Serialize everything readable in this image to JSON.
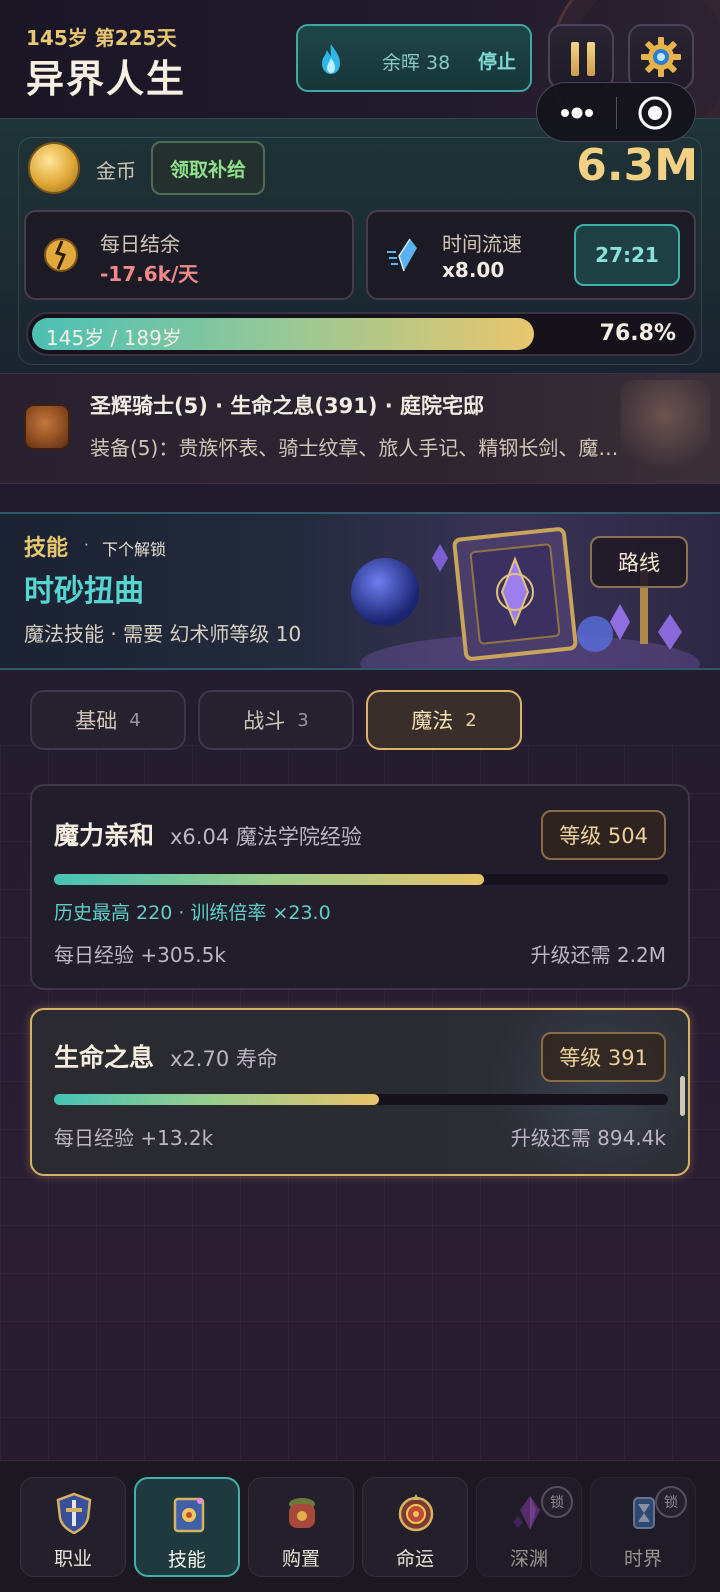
{
  "header": {
    "age_day": "145岁 第225天",
    "title": "异界人生",
    "afterglow_label": "余晖 38",
    "stop_label": "停止",
    "pause_icon": "pause-icon",
    "settings_icon": "gear-icon"
  },
  "resources": {
    "coin_label": "金币",
    "claim_button": "领取补给",
    "gold_amount": "6.3M",
    "daily_title": "每日结余",
    "daily_value": "-17.6k/天",
    "speed_title": "时间流速",
    "speed_value": "x8.00",
    "timer": "27:21",
    "life_text": "145岁 / 189岁",
    "life_percent": "76.8%",
    "life_progress": 0.768
  },
  "identity": {
    "line1": "圣辉骑士(5) · 生命之息(391) · 庭院宅邸",
    "line2": "装备(5)：贵族怀表、骑士纹章、旅人手记、精钢长剑、魔…"
  },
  "banner": {
    "section": "技能",
    "dot": "·",
    "next_unlock": "下个解锁",
    "skill_name": "时砂扭曲",
    "requirement": "魔法技能 · 需要 幻术师等级 10",
    "route_button": "路线"
  },
  "tabs": [
    {
      "label": "基础",
      "count": "4",
      "active": false
    },
    {
      "label": "战斗",
      "count": "3",
      "active": false
    },
    {
      "label": "魔法",
      "count": "2",
      "active": true
    }
  ],
  "cards": [
    {
      "name": "魔力亲和",
      "multiplier": "x6.04 魔法学院经验",
      "level": "等级 504",
      "progress": 0.7,
      "history": "历史最高 220 · 训练倍率 ×23.0",
      "daily_exp": "每日经验 +305.5k",
      "to_next": "升级还需 2.2M"
    },
    {
      "name": "生命之息",
      "multiplier": "x2.70 寿命",
      "level": "等级 391",
      "progress": 0.53,
      "daily_exp": "每日经验 +13.2k",
      "to_next": "升级还需 894.4k"
    }
  ],
  "nav": [
    {
      "label": "职业",
      "icon": "class-shield-icon",
      "active": false,
      "locked": false
    },
    {
      "label": "技能",
      "icon": "skill-book-icon",
      "active": true,
      "locked": false
    },
    {
      "label": "购置",
      "icon": "purchase-bag-icon",
      "active": false,
      "locked": false
    },
    {
      "label": "命运",
      "icon": "fate-compass-icon",
      "active": false,
      "locked": false
    },
    {
      "label": "深渊",
      "icon": "abyss-crystal-icon",
      "active": false,
      "locked": true
    },
    {
      "label": "时界",
      "icon": "time-realm-icon",
      "active": false,
      "locked": true
    }
  ],
  "lock_label": "锁",
  "colors": {
    "accent_teal": "#3fb0a8",
    "accent_gold": "#d6b262",
    "negative": "#f08a8a"
  }
}
